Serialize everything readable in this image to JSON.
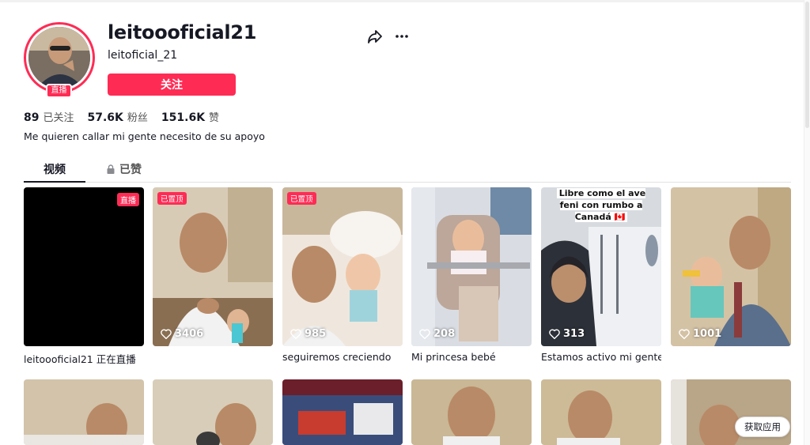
{
  "profile": {
    "username": "leitoooficial21",
    "nickname": "leitoficial_21",
    "live_badge": "直播",
    "follow_label": "关注",
    "stats": {
      "following_count": "89",
      "following_label": "已关注",
      "followers_count": "57.6K",
      "followers_label": "粉丝",
      "likes_count": "151.6K",
      "likes_label": "赞"
    },
    "bio": "Me quieren callar mi gente necesito de su apoyo"
  },
  "tabs": [
    {
      "label": "视频",
      "active": true
    },
    {
      "label": "已赞",
      "locked": true
    }
  ],
  "videos": [
    {
      "tag": "直播",
      "views": "",
      "caption": "leitoooficial21 正在直播"
    },
    {
      "pinned": "已置顶",
      "views": "3406",
      "caption": ""
    },
    {
      "pinned": "已置顶",
      "views": "985",
      "caption": "seguiremos creciendo"
    },
    {
      "views": "208",
      "caption": "Mi princesa bebé"
    },
    {
      "overlay": "Libre como el ave feni  con rumbo a Canadá 🇨🇦",
      "views": "313",
      "caption": "Estamos activo mi gente"
    },
    {
      "views": "1001",
      "caption": ""
    }
  ],
  "get_app_label": "获取应用",
  "colors": {
    "accent": "#fe2c55",
    "text": "#161823"
  }
}
